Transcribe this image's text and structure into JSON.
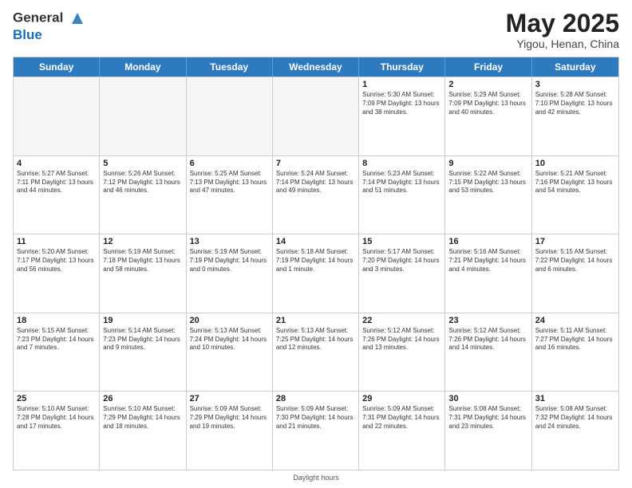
{
  "header": {
    "logo_line1": "General",
    "logo_line2": "Blue",
    "title": "May 2025",
    "subtitle": "Yigou, Henan, China"
  },
  "weekdays": [
    "Sunday",
    "Monday",
    "Tuesday",
    "Wednesday",
    "Thursday",
    "Friday",
    "Saturday"
  ],
  "weeks": [
    [
      {
        "day": "",
        "info": "",
        "empty": true
      },
      {
        "day": "",
        "info": "",
        "empty": true
      },
      {
        "day": "",
        "info": "",
        "empty": true
      },
      {
        "day": "",
        "info": "",
        "empty": true
      },
      {
        "day": "1",
        "info": "Sunrise: 5:30 AM\nSunset: 7:09 PM\nDaylight: 13 hours\nand 38 minutes.",
        "empty": false
      },
      {
        "day": "2",
        "info": "Sunrise: 5:29 AM\nSunset: 7:09 PM\nDaylight: 13 hours\nand 40 minutes.",
        "empty": false
      },
      {
        "day": "3",
        "info": "Sunrise: 5:28 AM\nSunset: 7:10 PM\nDaylight: 13 hours\nand 42 minutes.",
        "empty": false
      }
    ],
    [
      {
        "day": "4",
        "info": "Sunrise: 5:27 AM\nSunset: 7:11 PM\nDaylight: 13 hours\nand 44 minutes.",
        "empty": false
      },
      {
        "day": "5",
        "info": "Sunrise: 5:26 AM\nSunset: 7:12 PM\nDaylight: 13 hours\nand 46 minutes.",
        "empty": false
      },
      {
        "day": "6",
        "info": "Sunrise: 5:25 AM\nSunset: 7:13 PM\nDaylight: 13 hours\nand 47 minutes.",
        "empty": false
      },
      {
        "day": "7",
        "info": "Sunrise: 5:24 AM\nSunset: 7:14 PM\nDaylight: 13 hours\nand 49 minutes.",
        "empty": false
      },
      {
        "day": "8",
        "info": "Sunrise: 5:23 AM\nSunset: 7:14 PM\nDaylight: 13 hours\nand 51 minutes.",
        "empty": false
      },
      {
        "day": "9",
        "info": "Sunrise: 5:22 AM\nSunset: 7:15 PM\nDaylight: 13 hours\nand 53 minutes.",
        "empty": false
      },
      {
        "day": "10",
        "info": "Sunrise: 5:21 AM\nSunset: 7:16 PM\nDaylight: 13 hours\nand 54 minutes.",
        "empty": false
      }
    ],
    [
      {
        "day": "11",
        "info": "Sunrise: 5:20 AM\nSunset: 7:17 PM\nDaylight: 13 hours\nand 56 minutes.",
        "empty": false
      },
      {
        "day": "12",
        "info": "Sunrise: 5:19 AM\nSunset: 7:18 PM\nDaylight: 13 hours\nand 58 minutes.",
        "empty": false
      },
      {
        "day": "13",
        "info": "Sunrise: 5:19 AM\nSunset: 7:19 PM\nDaylight: 14 hours\nand 0 minutes.",
        "empty": false
      },
      {
        "day": "14",
        "info": "Sunrise: 5:18 AM\nSunset: 7:19 PM\nDaylight: 14 hours\nand 1 minute.",
        "empty": false
      },
      {
        "day": "15",
        "info": "Sunrise: 5:17 AM\nSunset: 7:20 PM\nDaylight: 14 hours\nand 3 minutes.",
        "empty": false
      },
      {
        "day": "16",
        "info": "Sunrise: 5:16 AM\nSunset: 7:21 PM\nDaylight: 14 hours\nand 4 minutes.",
        "empty": false
      },
      {
        "day": "17",
        "info": "Sunrise: 5:15 AM\nSunset: 7:22 PM\nDaylight: 14 hours\nand 6 minutes.",
        "empty": false
      }
    ],
    [
      {
        "day": "18",
        "info": "Sunrise: 5:15 AM\nSunset: 7:23 PM\nDaylight: 14 hours\nand 7 minutes.",
        "empty": false
      },
      {
        "day": "19",
        "info": "Sunrise: 5:14 AM\nSunset: 7:23 PM\nDaylight: 14 hours\nand 9 minutes.",
        "empty": false
      },
      {
        "day": "20",
        "info": "Sunrise: 5:13 AM\nSunset: 7:24 PM\nDaylight: 14 hours\nand 10 minutes.",
        "empty": false
      },
      {
        "day": "21",
        "info": "Sunrise: 5:13 AM\nSunset: 7:25 PM\nDaylight: 14 hours\nand 12 minutes.",
        "empty": false
      },
      {
        "day": "22",
        "info": "Sunrise: 5:12 AM\nSunset: 7:26 PM\nDaylight: 14 hours\nand 13 minutes.",
        "empty": false
      },
      {
        "day": "23",
        "info": "Sunrise: 5:12 AM\nSunset: 7:26 PM\nDaylight: 14 hours\nand 14 minutes.",
        "empty": false
      },
      {
        "day": "24",
        "info": "Sunrise: 5:11 AM\nSunset: 7:27 PM\nDaylight: 14 hours\nand 16 minutes.",
        "empty": false
      }
    ],
    [
      {
        "day": "25",
        "info": "Sunrise: 5:10 AM\nSunset: 7:28 PM\nDaylight: 14 hours\nand 17 minutes.",
        "empty": false
      },
      {
        "day": "26",
        "info": "Sunrise: 5:10 AM\nSunset: 7:29 PM\nDaylight: 14 hours\nand 18 minutes.",
        "empty": false
      },
      {
        "day": "27",
        "info": "Sunrise: 5:09 AM\nSunset: 7:29 PM\nDaylight: 14 hours\nand 19 minutes.",
        "empty": false
      },
      {
        "day": "28",
        "info": "Sunrise: 5:09 AM\nSunset: 7:30 PM\nDaylight: 14 hours\nand 21 minutes.",
        "empty": false
      },
      {
        "day": "29",
        "info": "Sunrise: 5:09 AM\nSunset: 7:31 PM\nDaylight: 14 hours\nand 22 minutes.",
        "empty": false
      },
      {
        "day": "30",
        "info": "Sunrise: 5:08 AM\nSunset: 7:31 PM\nDaylight: 14 hours\nand 23 minutes.",
        "empty": false
      },
      {
        "day": "31",
        "info": "Sunrise: 5:08 AM\nSunset: 7:32 PM\nDaylight: 14 hours\nand 24 minutes.",
        "empty": false
      }
    ]
  ],
  "footer": "Daylight hours"
}
